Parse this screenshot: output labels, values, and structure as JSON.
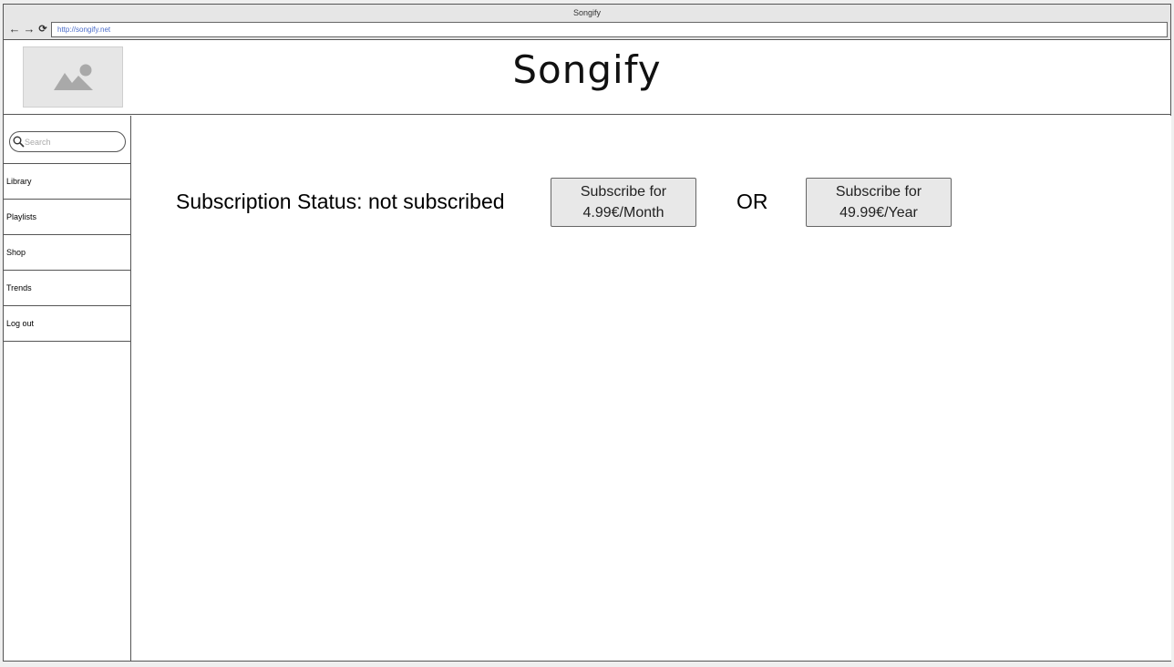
{
  "window": {
    "title": "Songify"
  },
  "browser": {
    "back_icon": "back-arrow-icon",
    "forward_icon": "forward-arrow-icon",
    "reload_icon": "reload-icon",
    "url": "http://songify.net"
  },
  "header": {
    "logo_icon": "image-placeholder-icon",
    "title": "Songify"
  },
  "sidebar": {
    "search_placeholder": "Search",
    "items": [
      {
        "label": "Library"
      },
      {
        "label": "Playlists"
      },
      {
        "label": "Shop"
      },
      {
        "label": "Trends"
      },
      {
        "label": "Log out"
      }
    ]
  },
  "main": {
    "status_text": "Subscription Status: not subscribed",
    "monthly": {
      "line1": "Subscribe for",
      "line2": "4.99€/Month"
    },
    "or_label": "OR",
    "yearly": {
      "line1": "Subscribe for",
      "line2": "49.99€/Year"
    }
  },
  "colors": {
    "button_bg": "#e8e8e8",
    "placeholder_bg": "#e6e6e6",
    "url_text": "#4b6cc9",
    "border": "#555555"
  }
}
